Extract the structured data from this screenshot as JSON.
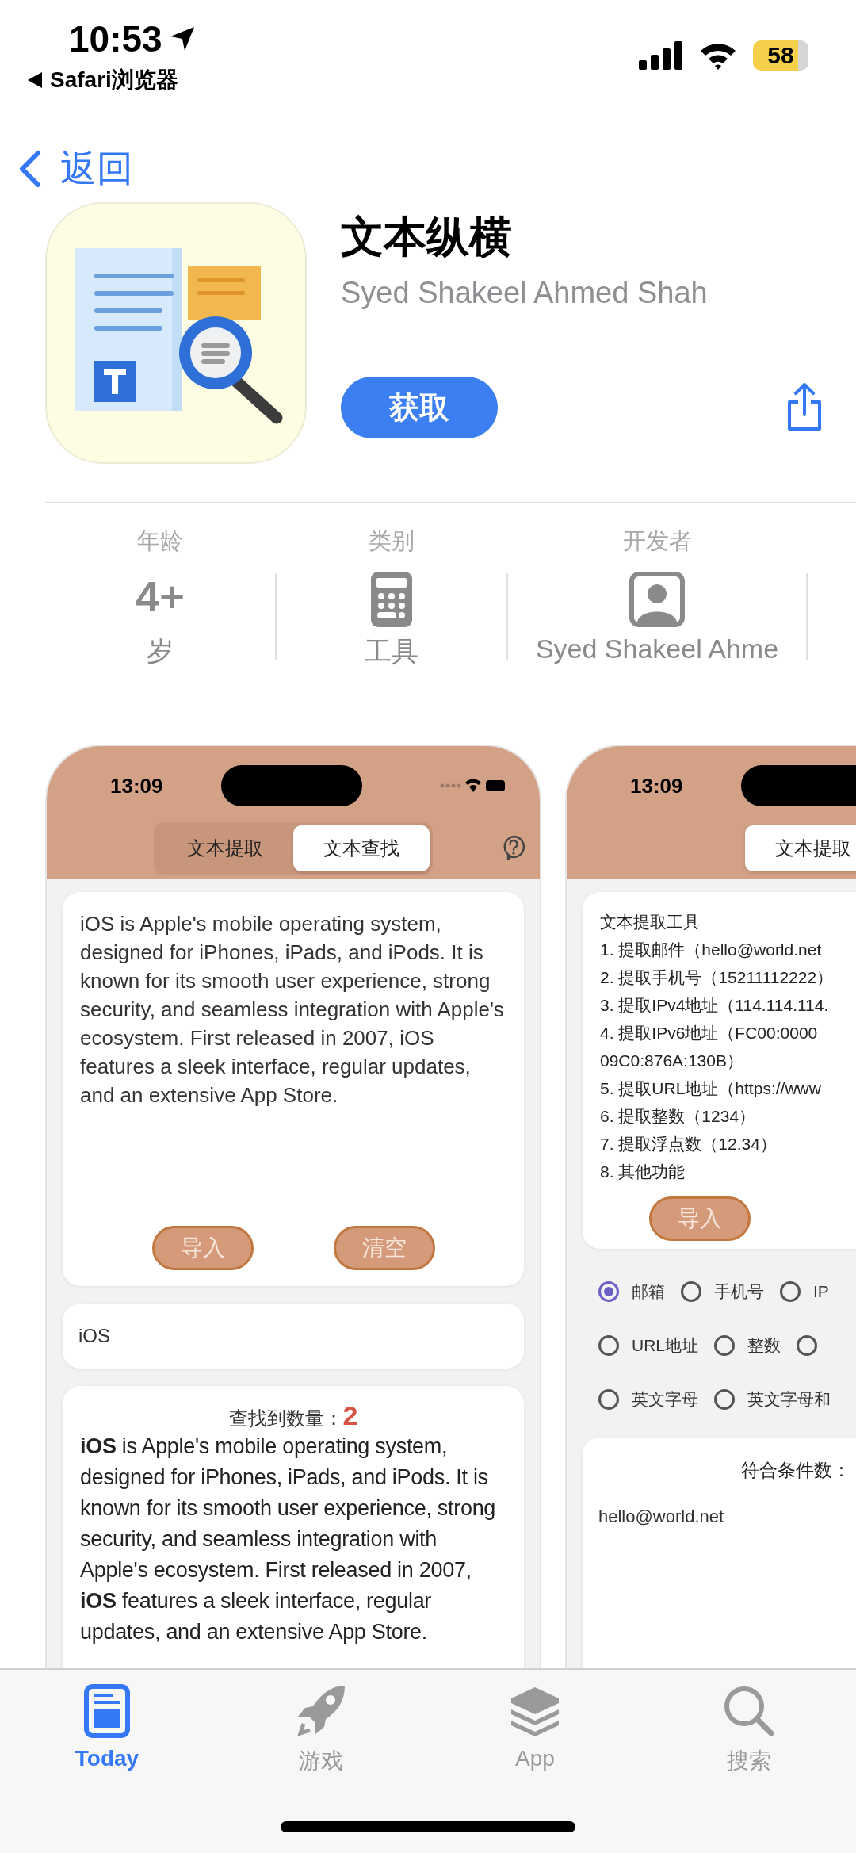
{
  "status_bar": {
    "time": "10:53",
    "back_app": "Safari浏览器",
    "battery": "58"
  },
  "nav": {
    "back": "返回"
  },
  "app": {
    "name": "文本纵横",
    "developer": "Syed Shakeel Ahmed Shah",
    "get_button": "获取"
  },
  "info": [
    {
      "kind": "text",
      "label": "年龄",
      "value": "4+",
      "caption": "岁"
    },
    {
      "kind": "calculator",
      "label": "类别",
      "caption": "工具"
    },
    {
      "kind": "person",
      "label": "开发者",
      "caption": "Syed Shakeel Ahme"
    }
  ],
  "screenshots": [
    {
      "kind": "search",
      "time": "13:09",
      "tabs": [
        {
          "label": "文本提取",
          "selected": false
        },
        {
          "label": "文本查找",
          "selected": true
        }
      ],
      "text": "iOS is Apple's mobile operating system, designed for iPhones, iPads, and iPods. It is known for its smooth user experience, strong security, and seamless integration with Apple's ecosystem. First released in 2007, iOS features a sleek interface, regular updates, and an extensive App Store.",
      "buttons": [
        "导入",
        "清空"
      ],
      "query": "iOS",
      "count_label": "查找到数量：",
      "count": "2",
      "result": "**iOS** is Apple's mobile operating system, designed for iPhones, iPads, and iPods. It is known for its smooth user experience, strong security, and seamless integration with Apple's ecosystem. First released in 2007, **iOS** features a sleek interface, regular updates, and an extensive App Store."
    },
    {
      "kind": "extract",
      "time": "13:09",
      "tabs": [
        {
          "label": "文本提取",
          "selected": true
        }
      ],
      "lines": [
        "文本提取工具",
        "1. 提取邮件（hello@world.net",
        "2. 提取手机号（15211112222）",
        "3. 提取IPv4地址（114.114.114.",
        "4. 提取IPv6地址（FC00:0000",
        "09C0:876A:130B）",
        "5. 提取URL地址（https://www",
        "6. 提取整数（1234）",
        "7. 提取浮点数（12.34）",
        "8. 其他功能"
      ],
      "buttons": [
        "导入"
      ],
      "option_rows": [
        {
          "options": [
            {
              "label": "邮箱",
              "selected": true
            },
            {
              "label": "手机号",
              "selected": false
            },
            {
              "label": "IP",
              "selected": false
            }
          ]
        },
        {
          "options": [
            {
              "label": "URL地址",
              "selected": false
            },
            {
              "label": "整数",
              "selected": false
            },
            {
              "selected": false
            }
          ]
        },
        {
          "options": [
            {
              "label": "英文字母",
              "selected": false
            },
            {
              "label": "英文字母和",
              "selected": false
            }
          ]
        }
      ],
      "result_label": "符合条件数：",
      "result": "hello@world.net"
    }
  ],
  "tab_bar": [
    {
      "kind": "today",
      "label": "Today",
      "selected": true
    },
    {
      "kind": "games",
      "label": "游戏",
      "selected": false
    },
    {
      "kind": "apps",
      "label": "App",
      "selected": false
    },
    {
      "kind": "search",
      "label": "搜索",
      "selected": false
    }
  ]
}
